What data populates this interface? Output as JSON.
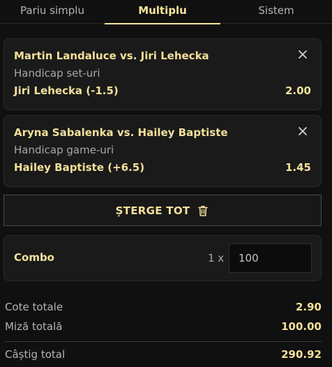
{
  "tabs": [
    {
      "label": "Pariu simplu",
      "active": false
    },
    {
      "label": "Multiplu",
      "active": true
    },
    {
      "label": "Sistem",
      "active": false
    }
  ],
  "bets": [
    {
      "event": "Martin Landaluce vs. Jiri Lehecka",
      "market": "Handicap set-uri",
      "selection": "Jiri Lehecka (-1.5)",
      "odds": "2.00",
      "close_icon": "close-icon"
    },
    {
      "event": "Aryna Sabalenka vs. Hailey Baptiste",
      "market": "Handicap game-uri",
      "selection": "Hailey Baptiste (+6.5)",
      "odds": "1.45",
      "close_icon": "close-icon"
    }
  ],
  "clear_button": {
    "label": "ȘTERGE TOT",
    "icon": "trash-icon"
  },
  "combo": {
    "label": "Combo",
    "multiplier": "1 x",
    "stake": "100"
  },
  "summary": {
    "total_odds_label": "Cote totale",
    "total_odds_value": "2.90",
    "total_stake_label": "Miză totală",
    "total_stake_value": "100.00",
    "total_win_label": "Câștig total",
    "total_win_value": "290.92"
  },
  "colors": {
    "accent": "#f3e09a",
    "background": "#101010",
    "card": "#1a1a1a",
    "muted_text": "#b4b4b4"
  }
}
